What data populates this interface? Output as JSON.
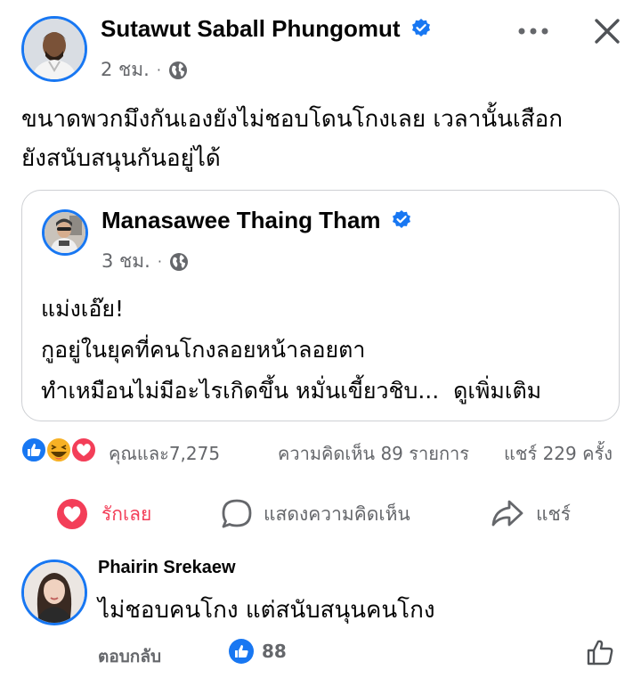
{
  "post": {
    "author": "Sutawut Saball Phungomut",
    "time": "2 ชม.",
    "text_lines": [
      "ขนาดพวกมึงกันเองยังไม่ชอบโดนโกงเลย เวลานั้นเสือก",
      "ยังสนับสนุนกันอยู่ได้"
    ]
  },
  "shared": {
    "author": "Manasawee Thaing Tham",
    "time": "3 ชม.",
    "text_lines": [
      "แม่งเอ๊ย!",
      "กูอยู่ในยุคที่คนโกงลอยหน้าลอยตา",
      "ทำเหมือนไม่มีอะไรเกิดขึ้น หมั่นเขี้ยวชิบ..."
    ],
    "see_more": "ดูเพิ่มเติม"
  },
  "stats": {
    "reactions_text": "คุณและ7,275",
    "comments_text": "ความคิดเห็น 89 รายการ",
    "shares_text": "แชร์ 229 ครั้ง"
  },
  "actions": {
    "love_label": "รักเลย",
    "comment_label": "แสดงความคิดเห็น",
    "share_label": "แชร์"
  },
  "comment": {
    "author": "Phairin Srekaew",
    "text": "ไม่ชอบคนโกง แต่สนับสนุนคนโกง",
    "reply_label": "ตอบกลับ",
    "like_count": "88"
  },
  "icons": {
    "more": "more-options-icon",
    "close": "close-icon",
    "verified": "verified-badge-icon",
    "audience": "globe-icon"
  },
  "colors": {
    "brand_blue": "#1877F2",
    "love_red": "#F33E58",
    "haha_yellow": "#F7B125",
    "secondary_text": "#65676B",
    "border": "#CED0D4"
  }
}
